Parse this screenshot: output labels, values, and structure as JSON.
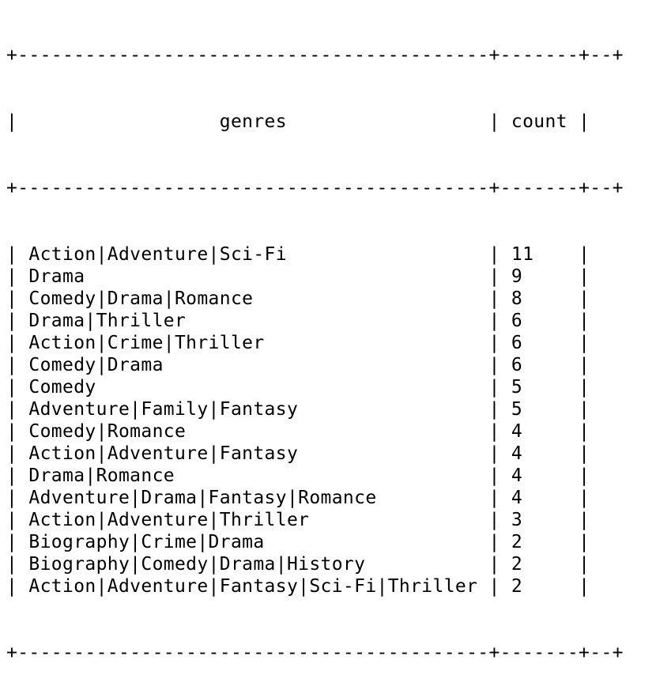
{
  "table": {
    "columns": [
      "genres",
      "count"
    ],
    "rows": [
      {
        "genres": "Action|Adventure|Sci-Fi",
        "count": "11"
      },
      {
        "genres": "Drama",
        "count": "9"
      },
      {
        "genres": "Comedy|Drama|Romance",
        "count": "8"
      },
      {
        "genres": "Drama|Thriller",
        "count": "6"
      },
      {
        "genres": "Action|Crime|Thriller",
        "count": "6"
      },
      {
        "genres": "Comedy|Drama",
        "count": "6"
      },
      {
        "genres": "Comedy",
        "count": "5"
      },
      {
        "genres": "Adventure|Family|Fantasy",
        "count": "5"
      },
      {
        "genres": "Comedy|Romance",
        "count": "4"
      },
      {
        "genres": "Action|Adventure|Fantasy",
        "count": "4"
      },
      {
        "genres": "Drama|Romance",
        "count": "4"
      },
      {
        "genres": "Adventure|Drama|Fantasy|Romance",
        "count": "4"
      },
      {
        "genres": "Action|Adventure|Thriller",
        "count": "3"
      },
      {
        "genres": "Biography|Crime|Drama",
        "count": "2"
      },
      {
        "genres": "Biography|Comedy|Drama|History",
        "count": "2"
      },
      {
        "genres": "Action|Adventure|Fantasy|Sci-Fi|Thriller",
        "count": "2"
      }
    ]
  }
}
